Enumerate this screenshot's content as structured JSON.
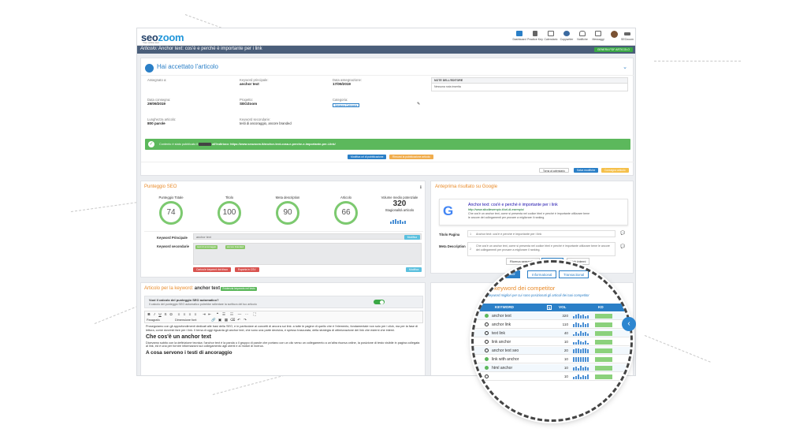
{
  "topbar": {
    "logo_main": "seo",
    "logo_oo": "zoom",
    "logo_sub": "Your online tool",
    "nav": [
      {
        "label": "Dashboard",
        "icon": "home-icon",
        "color": "#2a7fc7"
      },
      {
        "label": "Practice Key",
        "icon": "wrench-icon",
        "color": "#555555"
      },
      {
        "label": "Calendario",
        "icon": "calendar-icon",
        "color": "#555555"
      },
      {
        "label": "Copywriter",
        "icon": "users-icon",
        "color": "#555555"
      },
      {
        "label": "Notifiche",
        "icon": "bell-icon",
        "color": "#555555"
      },
      {
        "label": "Messaggi",
        "icon": "envelope-icon",
        "color": "#555555"
      },
      {
        "label": "",
        "icon": "avatar-icon",
        "color": "#7a5233"
      },
      {
        "label": "SEOzoom",
        "icon": "back-arrow-icon",
        "color": "#555555"
      }
    ]
  },
  "titlebar": {
    "prefix": "Articolo:",
    "title": "Anchor text: cos'è e perché è importante per i link",
    "action": "GENERA PDF ARTICOLO"
  },
  "accepted": {
    "heading": "Hai accettato l'articolo",
    "fields": [
      {
        "label": "Assegnato a:",
        "value": ""
      },
      {
        "label": "Keyword principale:",
        "value": "anchor text"
      },
      {
        "label": "Data assegnazione:",
        "value": "17/09/2019"
      },
      {
        "label": "Data consegna:",
        "value": "29/09/2019"
      },
      {
        "label": "Progetto:",
        "value": "SEOZoom"
      },
      {
        "label": "Categoria:",
        "value": "Nessuna Categoria"
      },
      {
        "label": "Lunghezza articolo:",
        "value": "800 parole"
      },
      {
        "label": "Keyword secondarie:",
        "value": "testi di ancoraggio, ancore branded"
      }
    ],
    "notes_title": "NOTE DELL'EDITORE",
    "notes_text": "Nessuna nota inserita",
    "published_msg": "Contento è stato pubblicato il",
    "published_url": "all'indirizzo: https://www.seozoom.it/anchor-text-cosa-e-perche-e-importante-per-i-link/",
    "btn_edit_pub": "Modifica url di pubblicazione",
    "btn_remove_pub": "Rimuovi la pubblicazione articolo",
    "btn_calendar": "Torna al calendario",
    "btn_save": "Salva modifiche",
    "btn_deliver": "Consegna articolo"
  },
  "seo_score": {
    "title": "Punteggio SEO",
    "metrics": [
      {
        "label": "Punteggio Totale",
        "value": "74"
      },
      {
        "label": "Titolo",
        "value": "100"
      },
      {
        "label": "Meta description",
        "value": "90"
      },
      {
        "label": "Articolo",
        "value": "66"
      }
    ],
    "volume_label": "Volume medio potenziale",
    "volume_value": "320",
    "seasonality_label": "Stagionalità articolo",
    "kw_main_label": "Keyword Principale",
    "kw_main_value": "anchor text",
    "kw_main_btn": "Modifica",
    "kw_sec_label": "Keyword secondarie",
    "kw_sec_tags": [
      "testi di ancoraggio",
      "ancore branded"
    ],
    "kw_sec_btn": "Modifica",
    "btn_load": "Carica le keyword dal disco",
    "btn_export": "Esporta in CSV"
  },
  "preview": {
    "title": "Anteprima risultato su Google",
    "serp_title": "Anchor text: cos'è e perché è importante per i link",
    "serp_url": "http://www.sitodiesempio.it/url-di-esempio/",
    "serp_desc": "Che cos'è un anchor text, come si presenta nel codice html e perché è importante utilizzare bene le ancore dei collegamenti per provare a migliorare il ranking.",
    "title_label": "Titolo Pagina",
    "title_num": "1",
    "title_value": "Anchor text: cos'è e perché è importante per i link",
    "meta_label": "Meta Description",
    "meta_num": "2",
    "meta_value": "Che cos'è un anchor text, come si presenta nel codice html e perché è importante utilizzare bene le ancore dei collegamenti per provare a migliorare il ranking.",
    "tabs": [
      "Ricerca semantica",
      "H1,H2,H3",
      "Link interni"
    ]
  },
  "editor": {
    "title_prefix": "Articolo per la keyword:",
    "title_kw": "anchor text",
    "title_badge": "Evidenzia keywords nel testo",
    "toggle_q": "Vuoi il calcolo del punteggio SEO automatico?",
    "toggle_desc": "Il calcolo del punteggio SEO automatico potrebbe rallentare la scrittura del tuo articolo",
    "format_label": "Paragrafo",
    "size_label": "Dimensione font",
    "body_p1": "Proseguiamo con gli approfondimenti dedicati alle basi della SEO, e in particolare ai concetti di ancora sui link: a tutte le pagine di quello che è l'elemento, fondamentale non solo per i click, ma per la fase di lettura, come dovresti fare per i link. Il tema di oggi riguarda gli anchor text, che sono una parte decisiva, e spesso trascurata, della strategia di ottimizzazione dei link che esterni che interni.",
    "h1": "Che cos'è un anchor text",
    "body_p2": "Dicevamo subito con la definizione tecnica: l'anchor text è la parola o il gruppo di parole che portano con un clic verso un collegamento a un'altra risorsa online, la posizione di testo visibile in pagina collegata al link, ed è una per fornire informazioni sul collegamento agli utenti e ai motori di ricerca.",
    "h2": "A cosa servono i testi di ancoraggio"
  },
  "competitor": {
    "tabs": [
      "Link del competitor",
      "Informational",
      "Transactional"
    ],
    "title": "Top keyword dei competitor",
    "subtitle": "Le keyword migliori per cui sono posizionati gli articoli dei tuoi competitor",
    "columns": [
      "KEYWORD",
      "VOL",
      "KD"
    ],
    "rows": [
      {
        "keyword": "anchor text",
        "vol": "320",
        "done": true
      },
      {
        "keyword": "anchor link",
        "vol": "110",
        "done": false
      },
      {
        "keyword": "text link",
        "vol": "40",
        "done": false
      },
      {
        "keyword": "link anchor",
        "vol": "10",
        "done": false
      },
      {
        "keyword": "anchor text seo",
        "vol": "20",
        "done": false
      },
      {
        "keyword": "link with anchor",
        "vol": "10",
        "done": true
      },
      {
        "keyword": "html anchor",
        "vol": "10",
        "done": true
      },
      {
        "keyword": "",
        "vol": "10",
        "done": false
      }
    ],
    "left_partial": [
      "SE",
      "P",
      "TITOL"
    ]
  },
  "colors": {
    "accent": "#2a7fc7",
    "orange": "#e98b2a",
    "green": "#5cb85c",
    "navy": "#4a5e7a"
  }
}
